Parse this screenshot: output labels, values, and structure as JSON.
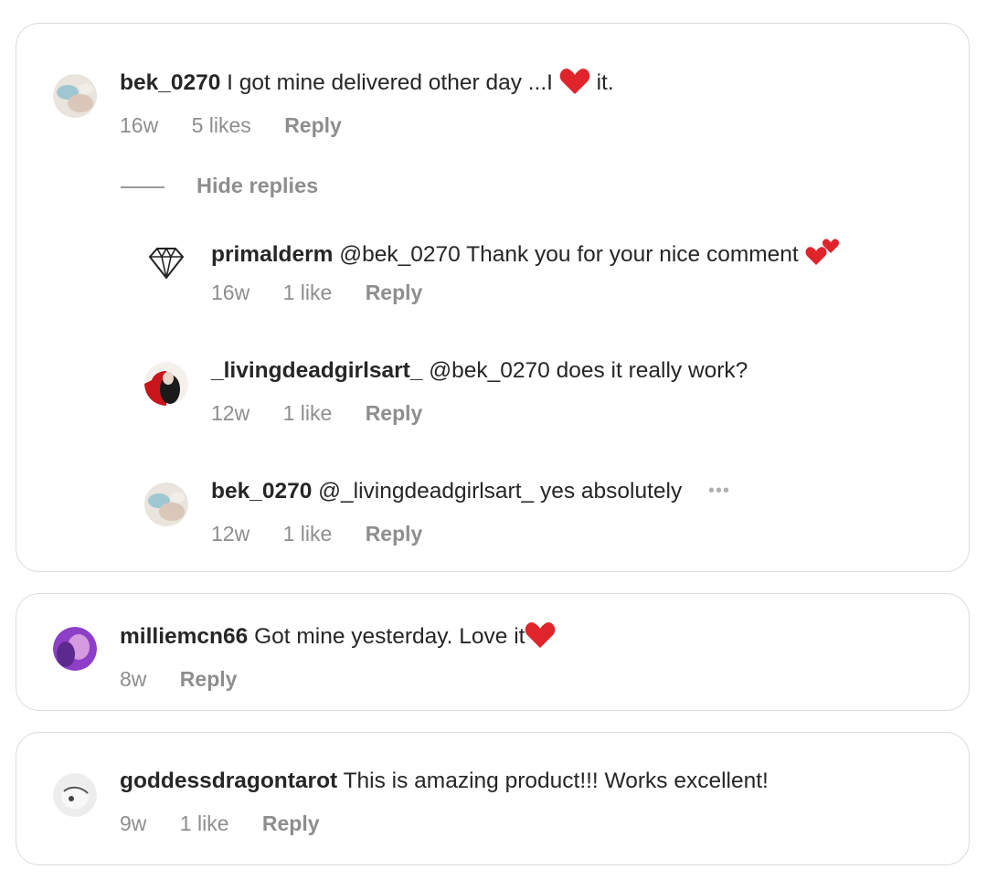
{
  "threads": [
    {
      "username": "bek_0270",
      "text_before": "I got mine delivered other day ...I",
      "emoji": "heart",
      "text_after": "it.",
      "age": "16w",
      "likes": "5 likes",
      "reply_label": "Reply",
      "hide_replies_label": "Hide replies",
      "replies": [
        {
          "username": "primalderm",
          "text": "@bek_0270 Thank you for your nice comment",
          "emoji": "two-hearts",
          "age": "16w",
          "likes": "1 like",
          "reply_label": "Reply",
          "avatar_icon": "diamond-icon"
        },
        {
          "username": "_livingdeadgirlsart_",
          "text": "@bek_0270 does it really work?",
          "age": "12w",
          "likes": "1 like",
          "reply_label": "Reply"
        },
        {
          "username": "bek_0270",
          "text": "@_livingdeadgirlsart_ yes absolutely",
          "age": "12w",
          "likes": "1 like",
          "reply_label": "Reply",
          "more_icon": "more-options-icon"
        }
      ]
    },
    {
      "username": "milliemcn66",
      "text": "Got mine yesterday. Love it",
      "emoji": "heart",
      "age": "8w",
      "reply_label": "Reply"
    },
    {
      "username": "goddessdragontarot",
      "text": "This is amazing product!!! Works excellent!",
      "age": "9w",
      "likes": "1 like",
      "reply_label": "Reply"
    }
  ],
  "colors": {
    "text": "#262626",
    "meta": "#8e8e8e",
    "border": "#dcdcdc",
    "heart": "#e0242c"
  }
}
